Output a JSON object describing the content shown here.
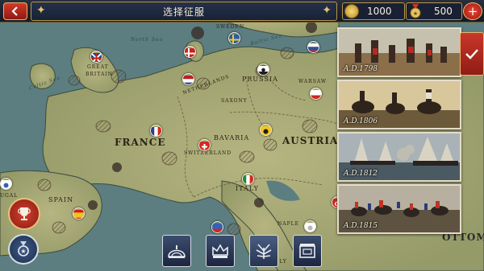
{
  "header": {
    "back_icon": "back-arrow-icon",
    "title": "选择征服",
    "coins": "1000",
    "medals": "500",
    "add_icon": "plus-icon"
  },
  "map": {
    "labels": {
      "sweden": "SWEDEN",
      "great_britain_1": "GREAT",
      "great_britain_2": "BRITAIN",
      "netherlands": "NETHERLANDS",
      "prussia": "PRUSSIA",
      "warsaw": "WARSAW",
      "saxony": "SAXONY",
      "france": "FRANCE",
      "switzerland": "SWITZERLAND",
      "bavaria": "BAVARIA",
      "austria": "AUSTRIA",
      "italy": "ITALY",
      "spain": "SPAIN",
      "portugal_partial": "UGAL",
      "naples_partial": "NAPLE",
      "sicily_partial": "ICILY",
      "ottoman_partial": "OTTOM",
      "north_sea": "North Sea",
      "baltic_sea": "Baltic Sea",
      "celtic_sea": "Celtic Sea"
    }
  },
  "campaigns": [
    {
      "date": "A.D.1798"
    },
    {
      "date": "A.D.1806"
    },
    {
      "date": "A.D.1812"
    },
    {
      "date": "A.D.1815"
    }
  ],
  "controls": {
    "confirm_icon": "checkmark-icon",
    "trophy_icon": "trophy-icon",
    "medal_icon": "medal-icon",
    "bottom_icons": [
      "dome-icon",
      "crown-icon",
      "laurel-icon",
      "building-icon"
    ]
  },
  "colors": {
    "accent_red": "#c9372a",
    "gold_border": "#b99745",
    "sea": "#5d7f80",
    "land": "#a8ab76"
  }
}
